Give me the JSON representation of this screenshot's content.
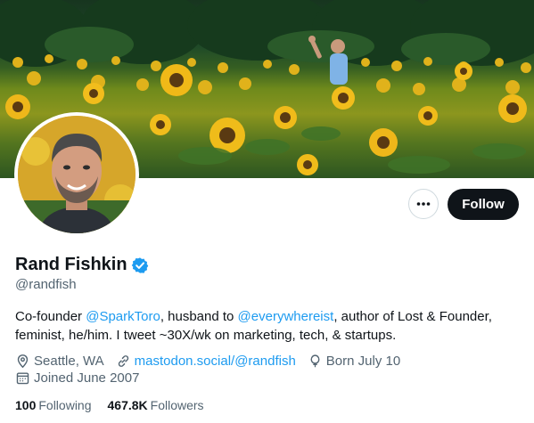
{
  "profile": {
    "name": "Rand Fishkin",
    "handle": "@randfish",
    "follow_label": "Follow",
    "bio": {
      "t1": "Co-founder ",
      "m1": "@SparkToro",
      "t2": ", husband to ",
      "m2": "@everywhereist",
      "t3": ", author of Lost & Founder, feminist, he/him. I tweet ~30X/wk on marketing, tech, & startups."
    },
    "location": "Seattle, WA",
    "website": "mastodon.social/@randfish",
    "born": "Born July 10",
    "joined": "Joined June 2007",
    "following_count": "100",
    "following_label": "Following",
    "followers_count": "467.8K",
    "followers_label": "Followers"
  },
  "colors": {
    "accent": "#1d9bf0",
    "text": "#0f1419",
    "muted": "#536471",
    "follow_bg": "#0f1419"
  },
  "icons": [
    "more-icon",
    "verified-badge-icon",
    "location-icon",
    "link-icon",
    "birthday-icon",
    "calendar-icon"
  ]
}
